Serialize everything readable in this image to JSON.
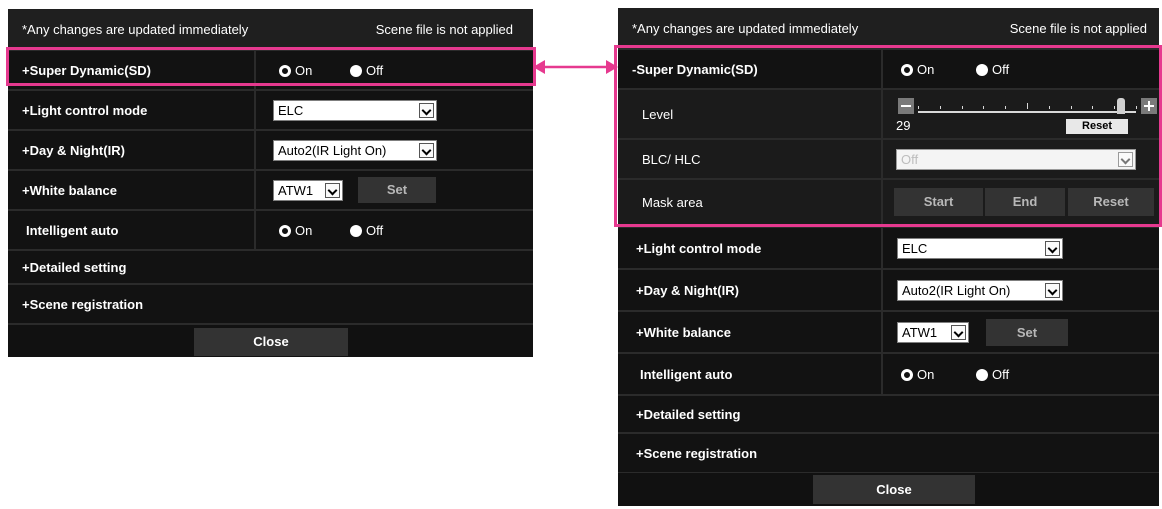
{
  "left_panel": {
    "info": {
      "message": "*Any changes are updated immediately",
      "scene_status": "Scene file is not applied"
    },
    "super_dynamic": {
      "label": "+Super Dynamic(SD)",
      "on": "On",
      "off": "Off",
      "selected": "On"
    },
    "light_control": {
      "label": "+Light control mode",
      "value": "ELC"
    },
    "day_night": {
      "label": "+Day & Night(IR)",
      "value": "Auto2(IR Light On)"
    },
    "white_balance": {
      "label": "+White balance",
      "value": "ATW1",
      "set_label": "Set"
    },
    "intelligent_auto": {
      "label": "Intelligent auto",
      "on": "On",
      "off": "Off",
      "selected": "On"
    },
    "detailed_setting": {
      "label": "+Detailed setting"
    },
    "scene_registration": {
      "label": "+Scene registration"
    },
    "close_label": "Close"
  },
  "right_panel": {
    "info": {
      "message": "*Any changes are updated immediately",
      "scene_status": "Scene file is not applied"
    },
    "super_dynamic": {
      "label": "-Super Dynamic(SD)",
      "on": "On",
      "off": "Off",
      "selected": "On"
    },
    "level": {
      "label": "Level",
      "value": "29",
      "reset_label": "Reset",
      "slider_fraction": 0.93
    },
    "blc_hlc": {
      "label": "BLC/ HLC",
      "value": "Off",
      "disabled": true
    },
    "mask_area": {
      "label": "Mask area",
      "start_label": "Start",
      "end_label": "End",
      "reset_label": "Reset"
    },
    "light_control": {
      "label": "+Light control mode",
      "value": "ELC"
    },
    "day_night": {
      "label": "+Day & Night(IR)",
      "value": "Auto2(IR Light On)"
    },
    "white_balance": {
      "label": "+White balance",
      "value": "ATW1",
      "set_label": "Set"
    },
    "intelligent_auto": {
      "label": "Intelligent auto",
      "on": "On",
      "off": "Off",
      "selected": "On"
    },
    "detailed_setting": {
      "label": "+Detailed setting"
    },
    "scene_registration": {
      "label": "+Scene registration"
    },
    "close_label": "Close"
  },
  "colors": {
    "highlight": "#e6398f",
    "panel_bg": "#121212",
    "button_bg": "#333333"
  },
  "icons": {
    "connector": "double-arrow-icon",
    "slider_minus": "minus-icon",
    "slider_plus": "plus-icon",
    "dropdown": "chevron-down-icon"
  }
}
